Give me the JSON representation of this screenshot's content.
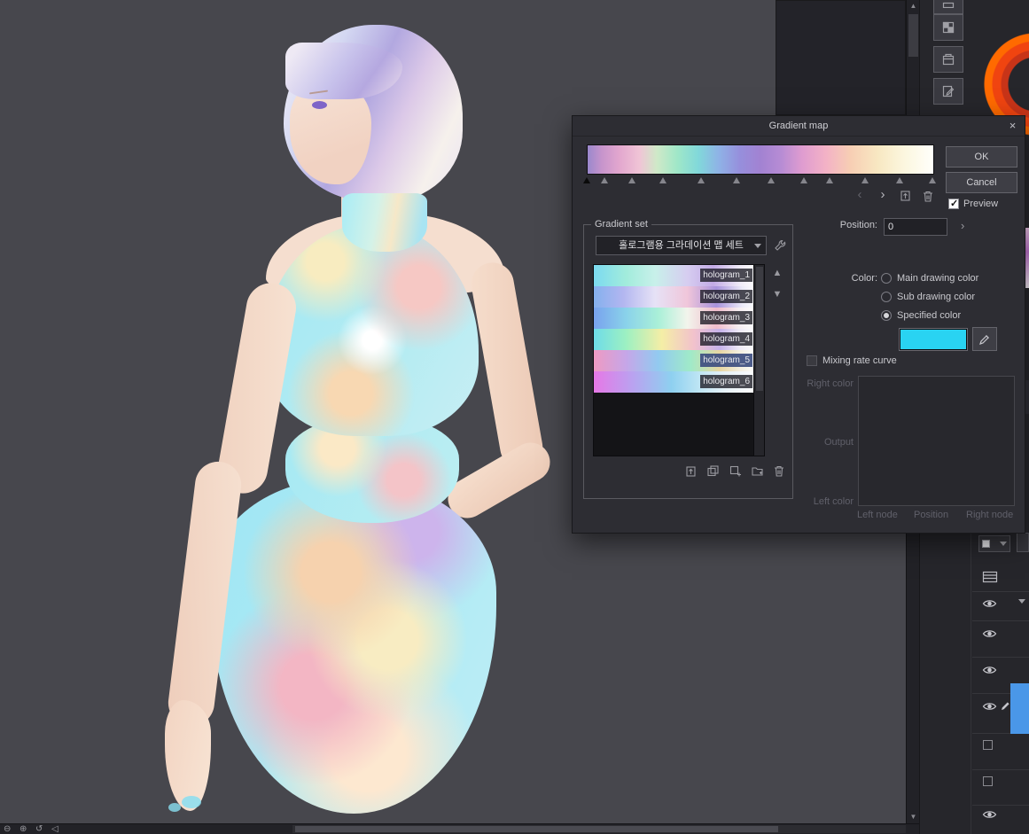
{
  "dialog": {
    "title": "Gradient map",
    "close_glyph": "×",
    "buttons": {
      "ok": "OK",
      "cancel": "Cancel"
    },
    "nav": {
      "prev_glyph": "‹",
      "next_glyph": "›"
    },
    "preview_label": "Preview",
    "position_label": "Position:",
    "position_value": "0",
    "position_step_glyph": "›",
    "gradient_bar": {
      "css": "background:linear-gradient(90deg,#9a88cc 0%,#c694cc 4%,#e2a6ce 9%,#f0c4d6 15%,#cfe9c8 20%,#9fe7c8 26%,#81d8da 32%,#8fb2e6 38%,#968fdc 44%,#a282d2 50%,#b78cd4 56%,#df9cd0 62%,#f3b2c6 69%,#f7ceb4 76%,#f8e8c2 84%,#fcf7e0 92%,#fffffb 100%)",
      "markers": [
        {
          "pos": 0,
          "selected": true
        },
        {
          "pos": 5
        },
        {
          "pos": 13
        },
        {
          "pos": 22
        },
        {
          "pos": 33
        },
        {
          "pos": 43
        },
        {
          "pos": 53
        },
        {
          "pos": 62.5
        },
        {
          "pos": 70
        },
        {
          "pos": 80
        },
        {
          "pos": 90
        },
        {
          "pos": 99.5
        }
      ]
    },
    "gradient_set": {
      "legend": "Gradient set",
      "dropdown_value": "홀로그램용 그라데이션 맵 세트",
      "up_glyph": "▲",
      "down_glyph": "▼",
      "selected_item": "hologram_5",
      "items": [
        {
          "label": "hologram_1",
          "css": "background:linear-gradient(90deg,#7bdaf0 0%,#a2ecdc 20%,#c8f0ea 38%,#d6cdf0 58%,#c3abe6 74%,#efeaf7 90%,#fdfdfd 100%)"
        },
        {
          "label": "hologram_2",
          "css": "background:linear-gradient(90deg,#84b0ee 0%,#b2b6f0 18%,#e6e2f6 38%,#f0c6da 58%,#a893dc 76%,#eceaf8 92%,#fdfdfd 100%)"
        },
        {
          "label": "hologram_3",
          "css": "background:linear-gradient(90deg,#78a2ee 0%,#8ad2ea 20%,#aaf0d8 40%,#f2f4ec 58%,#f0bccc 76%,#f6eef2 90%,#fdfdfd 100%)"
        },
        {
          "label": "hologram_4",
          "css": "background:linear-gradient(90deg,#6edce8 0%,#9df0c2 20%,#f4eea6 42%,#f2c2cc 62%,#c6b2ea 78%,#efeaf7 90%,#fdfdfd 100%)"
        },
        {
          "label": "hologram_5",
          "css": "background:linear-gradient(90deg,#ee9ac2 0%,#c6a6e8 20%,#92caf0 40%,#a0eac8 60%,#e8d6a2 78%,#f4eede 90%,#fdfdfd 100%)"
        },
        {
          "label": "hologram_6",
          "css": "background:linear-gradient(90deg,#e678e6 0%,#baa2f0 24%,#8ed0f0 48%,#c0e6f4 66%,#e8f2f8 82%,#fdfdfd 100%)"
        }
      ]
    },
    "color_section": {
      "label": "Color:",
      "options": [
        {
          "label": "Main drawing color",
          "selected": false
        },
        {
          "label": "Sub drawing color",
          "selected": false
        },
        {
          "label": "Specified color",
          "selected": true
        }
      ],
      "swatch_color": "#29d3f2",
      "swatch_css": "background:#29d3f2"
    },
    "mixing_label": "Mixing rate curve",
    "node_editor": {
      "right_color_label": "Right color",
      "output_label": "Output",
      "left_color_label": "Left color",
      "left_node_label": "Left node",
      "position_label": "Position",
      "right_node_label": "Right node"
    }
  },
  "right_panel": {
    "layer_color": "#4a97e8",
    "layer_color_css": "background:#4a97e8"
  },
  "scrollbars": {
    "up_glyph": "▲",
    "down_glyph": "▼"
  },
  "status_bar": {
    "icons": [
      {
        "name": "zoom-out",
        "glyph": "⊖"
      },
      {
        "name": "zoom-in",
        "glyph": "⊕"
      },
      {
        "name": "rotate-reset",
        "glyph": "↺"
      },
      {
        "name": "flip-view",
        "glyph": "◁"
      }
    ]
  }
}
